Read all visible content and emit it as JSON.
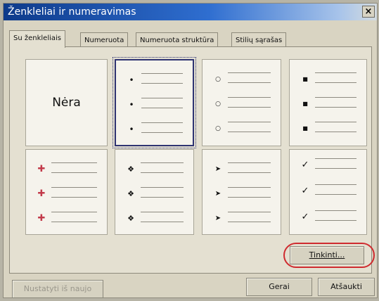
{
  "window": {
    "title": "Ženkleliai ir numeravimas",
    "close_label": "×"
  },
  "tabs": [
    {
      "label": "Su ženkleliais",
      "active": true
    },
    {
      "label": "Numeruota",
      "active": false
    },
    {
      "label": "Numeruota struktūra",
      "active": false
    },
    {
      "label": "Stilių sąrašas",
      "active": false
    }
  ],
  "gallery": {
    "none_label": "Nėra",
    "selected_index": 1,
    "items": [
      {
        "bullet": "none",
        "glyph": ""
      },
      {
        "bullet": "filled-dot",
        "glyph": "•"
      },
      {
        "bullet": "hollow-circle",
        "glyph": "○"
      },
      {
        "bullet": "filled-square",
        "glyph": "■"
      },
      {
        "bullet": "picture-bullet",
        "glyph": "✚"
      },
      {
        "bullet": "four-diamond",
        "glyph": "❖"
      },
      {
        "bullet": "arrowhead",
        "glyph": "➤"
      },
      {
        "bullet": "checkmark",
        "glyph": "✓"
      }
    ]
  },
  "buttons": {
    "customize": "Tinkinti...",
    "reset": "Nustatyti iš naujo",
    "ok": "Gerai",
    "cancel": "Atšaukti"
  },
  "colors": {
    "accent_highlight": "#cf2b2f",
    "title_gradient_start": "#0d3a8a"
  }
}
